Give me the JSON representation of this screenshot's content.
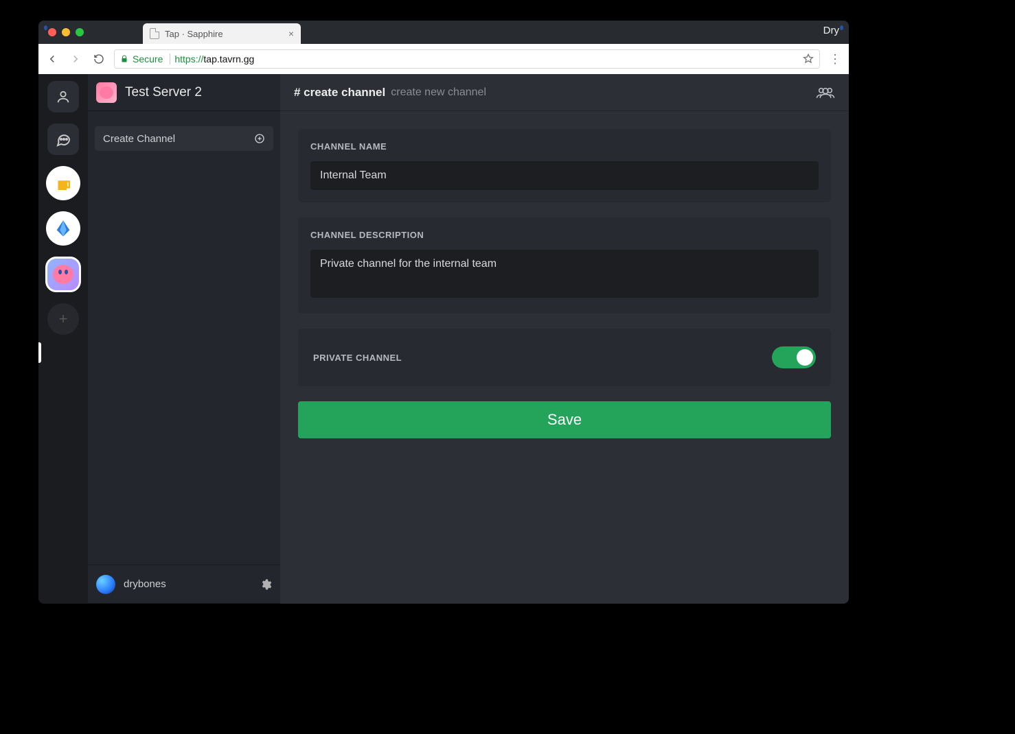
{
  "browser": {
    "tab_title": "Tap · Sapphire",
    "url_proto": "https://",
    "url_host": "tap.tavrn.gg",
    "secure_label": "Secure",
    "menubar_right": "Dry"
  },
  "rail": {
    "active_index": 4
  },
  "sidebar": {
    "server_name": "Test Server 2",
    "create_channel": "Create Channel"
  },
  "user": {
    "name": "drybones"
  },
  "header": {
    "title": "# create channel",
    "subtitle": "create new channel"
  },
  "form": {
    "channel_name_label": "CHANNEL NAME",
    "channel_name_value": "Internal Team",
    "channel_desc_label": "CHANNEL DESCRIPTION",
    "channel_desc_value": "Private channel for the internal team",
    "private_label": "PRIVATE CHANNEL",
    "private_on": true,
    "save_label": "Save"
  }
}
